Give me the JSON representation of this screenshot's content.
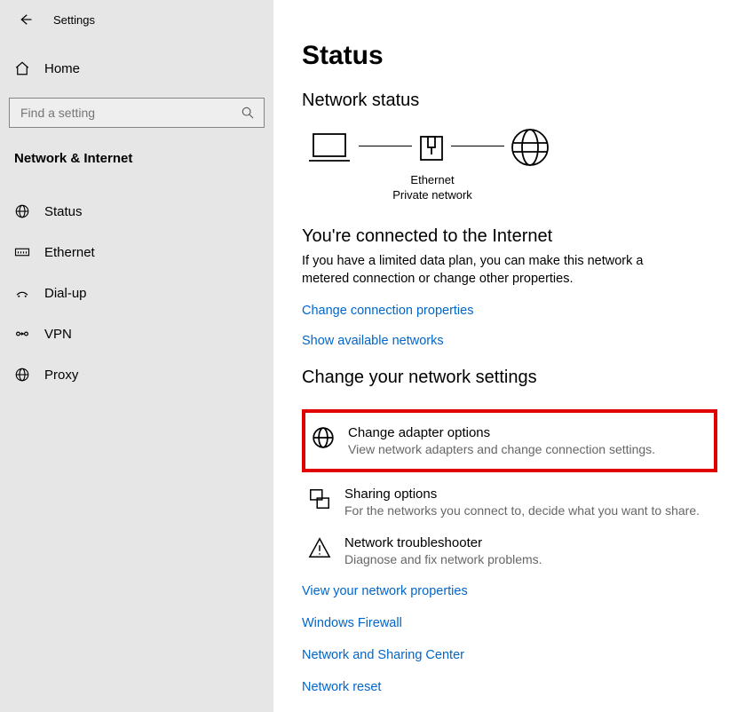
{
  "titlebar": {
    "title": "Settings"
  },
  "sidebar": {
    "home_label": "Home",
    "search_placeholder": "Find a setting",
    "section_title": "Network & Internet",
    "items": [
      {
        "label": "Status",
        "icon": "globe"
      },
      {
        "label": "Ethernet",
        "icon": "ethernet"
      },
      {
        "label": "Dial-up",
        "icon": "dialup"
      },
      {
        "label": "VPN",
        "icon": "vpn"
      },
      {
        "label": "Proxy",
        "icon": "globe"
      }
    ]
  },
  "main": {
    "page_title": "Status",
    "status_heading": "Network status",
    "diagram": {
      "connection_label": "Ethernet",
      "network_type": "Private network"
    },
    "connected_title": "You're connected to the Internet",
    "connected_desc": "If you have a limited data plan, you can make this network a metered connection or change other properties.",
    "link_change_props": "Change connection properties",
    "link_show_networks": "Show available networks",
    "settings_heading": "Change your network settings",
    "rows": [
      {
        "title": "Change adapter options",
        "desc": "View network adapters and change connection settings."
      },
      {
        "title": "Sharing options",
        "desc": "For the networks you connect to, decide what you want to share."
      },
      {
        "title": "Network troubleshooter",
        "desc": "Diagnose and fix network problems."
      }
    ],
    "bottom_links": [
      "View your network properties",
      "Windows Firewall",
      "Network and Sharing Center",
      "Network reset"
    ]
  }
}
